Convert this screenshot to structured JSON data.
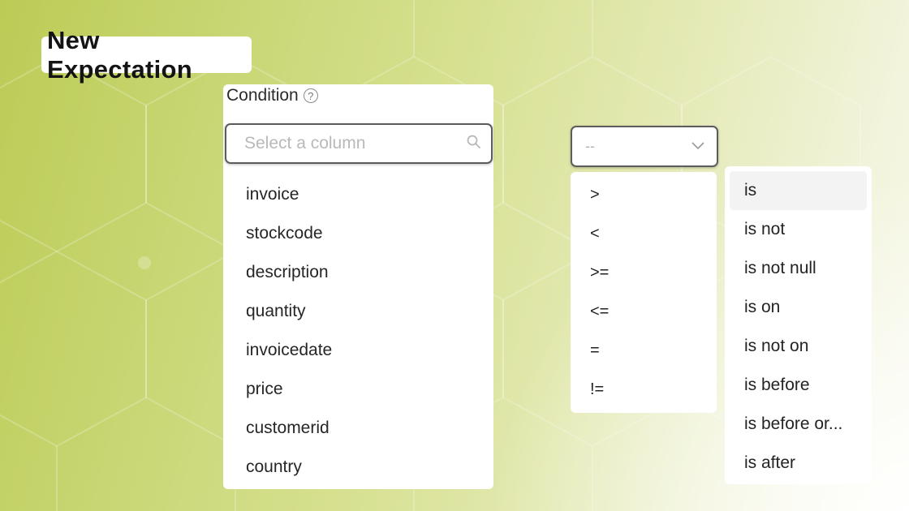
{
  "title": "New Expectation",
  "condition": {
    "label": "Condition",
    "help_glyph": "?",
    "search_placeholder": "Select a column",
    "columns": [
      "invoice",
      "stockcode",
      "description",
      "quantity",
      "invoicedate",
      "price",
      "customerid",
      "country"
    ]
  },
  "operator": {
    "selected": "--",
    "options": [
      ">",
      "<",
      ">=",
      "<=",
      "=",
      "!="
    ]
  },
  "comparator": {
    "options": [
      "is",
      "is not",
      "is not null",
      "is on",
      "is not on",
      "is before",
      "is before or...",
      "is after"
    ],
    "highlighted": "is"
  },
  "icons": {
    "help": "question-circle-icon",
    "search": "search-icon",
    "chevron": "chevron-down-icon"
  },
  "colors": {
    "background_left": "#bccb55",
    "background_right": "#f8f9ec",
    "border": "#5c5c5c",
    "placeholder": "#b9b9b9"
  }
}
